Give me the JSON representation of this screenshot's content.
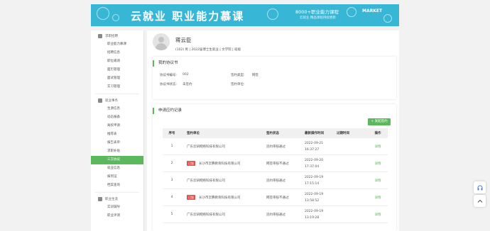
{
  "banner": {
    "title": "云就业 职业能力慕课",
    "course_line": "8000+职业能力课程",
    "sub_line": "云就业  精品课程持续更新",
    "market": "MARKET"
  },
  "sidebar": {
    "sections": [
      {
        "title": "求职招聘",
        "icon": "user-icon",
        "items": [
          "职业能力慕课",
          "招聘信息",
          "职位邀请",
          "面历管理",
          "面试管理",
          "实习管理"
        ]
      },
      {
        "title": "就业事务",
        "icon": "briefcase-icon",
        "items": [
          "生源信息",
          "动态报备",
          "离校申请",
          "推荐表",
          "报告表单",
          "求职补贴",
          "三方协议",
          "就业信息",
          "报到证",
          "档案查询"
        ]
      },
      {
        "title": "职业生涯",
        "icon": "book-icon",
        "items": [
          "实训辅导",
          "职业评测"
        ]
      }
    ],
    "active_item": "三方协议"
  },
  "profile": {
    "name": "蒋云臣",
    "meta": "(102) 男 | 2022届博士生就业 | 文学院 | 班级"
  },
  "agreement": {
    "title": "我的协议书",
    "labels": {
      "number": "协议书编号:",
      "status": "协议书状态:",
      "sign_type": "签约类型:",
      "sign_unit": "签约单位:"
    },
    "values": {
      "number": "002",
      "status": "未签约",
      "sign_type": "网签",
      "sign_unit": ""
    }
  },
  "records": {
    "title": "申请应约记录",
    "add_button": "+ 发起签约",
    "columns": [
      "序号",
      "签约单位",
      "签约状态",
      "最新操作时间",
      "过期时间",
      "操作"
    ],
    "rows": [
      {
        "index": "1",
        "tag": "",
        "unit": "广东云研网络科技有限公司",
        "status": "违约审核通过",
        "time": "2022-09-21 16:37:27",
        "expire": "",
        "action": "详情"
      },
      {
        "index": "2",
        "tag": "已毁",
        "unit": "长沙市云腾教育科技有限公司",
        "status": "网签审核不通过",
        "time": "2022-09-20 17:37:04",
        "expire": "",
        "action": "详情"
      },
      {
        "index": "3",
        "tag": "",
        "unit": "广东云研网络科技有限公司",
        "status": "违约审核通过",
        "time": "2022-09-19 17:15:14",
        "expire": "",
        "action": "详情"
      },
      {
        "index": "4",
        "tag": "已毁",
        "unit": "长沙市云腾教育科技有限公司",
        "status": "网签审核不通过",
        "time": "2022-09-19 13:58:52",
        "expire": "",
        "action": "详情"
      },
      {
        "index": "5",
        "tag": "",
        "unit": "广东云研网络科技有限公司",
        "status": "违约审核通过",
        "time": "2022-09-19 13:19:28",
        "expire": "",
        "action": "详情"
      }
    ]
  },
  "colors": {
    "accent": "#5cb85c",
    "banner": "#37b6d6",
    "tag": "#e94b4b"
  }
}
